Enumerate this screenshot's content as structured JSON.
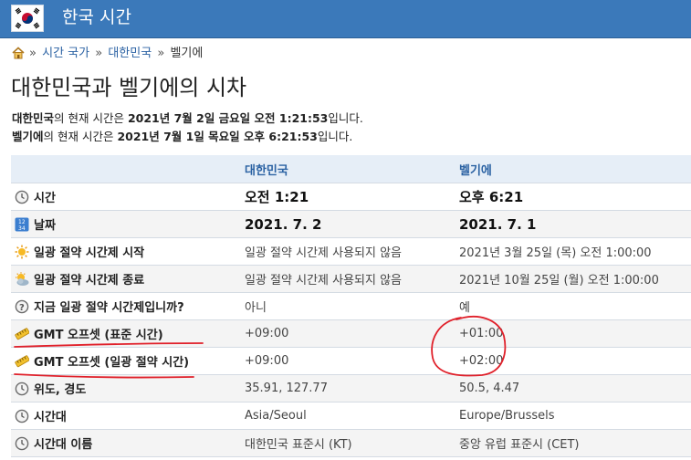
{
  "header": {
    "title": "한국 시간"
  },
  "breadcrumb": {
    "items": [
      "시간 국가",
      "대한민국",
      "벨기에"
    ],
    "sep": "»"
  },
  "page_title": "대한민국과 벨기에의 시차",
  "summary": {
    "line1": {
      "place": "대한민국",
      "mid": "의 현재 시간은 ",
      "time": "2021년 7월 2일 금요일 오전 1:21:53",
      "end": "입니다."
    },
    "line2": {
      "place": "벨기에",
      "mid": "의 현재 시간은 ",
      "time": "2021년 7월 1일 목요일 오후 6:21:53",
      "end": "입니다."
    }
  },
  "table": {
    "headers": [
      "대한민국",
      "벨기에"
    ],
    "rows": [
      {
        "icon": "clock-icon",
        "label": "시간",
        "a": "오전 1:21",
        "b": "오후 6:21"
      },
      {
        "icon": "calendar-icon",
        "label": "날짜",
        "a": "2021. 7. 2",
        "b": "2021. 7. 1"
      },
      {
        "icon": "sun-icon",
        "label": "일광 절약 시간제 시작",
        "a": "일광 절약 시간제 사용되지 않음",
        "b": "2021년 3월 25일 (목) 오전 1:00:00"
      },
      {
        "icon": "sun-cloud-icon",
        "label": "일광 절약 시간제 종료",
        "a": "일광 절약 시간제 사용되지 않음",
        "b": "2021년 10월 25일 (월) 오전 1:00:00"
      },
      {
        "icon": "question-icon",
        "label": "지금 일광 절약 시간제입니까?",
        "a": "아니",
        "b": "예"
      },
      {
        "icon": "ruler-icon",
        "label": "GMT 오프셋 (표준 시간)",
        "a": "+09:00",
        "b": "+01:00"
      },
      {
        "icon": "ruler-icon",
        "label": "GMT 오프셋 (일광 절약 시간)",
        "a": "+09:00",
        "b": "+02:00"
      },
      {
        "icon": "clock-icon",
        "label": "위도, 경도",
        "a": "35.91, 127.77",
        "b": "50.5, 4.47"
      },
      {
        "icon": "clock-icon",
        "label": "시간대",
        "a": "Asia/Seoul",
        "b": "Europe/Brussels"
      },
      {
        "icon": "clock-icon",
        "label": "시간대 이름",
        "a": "대한민국 표준시 (KT)",
        "b": "중앙 유럽 표준시 (CET)"
      }
    ]
  },
  "colors": {
    "header": "#3b79ba",
    "link": "#2b62a3",
    "annotation": "#e0202a"
  }
}
